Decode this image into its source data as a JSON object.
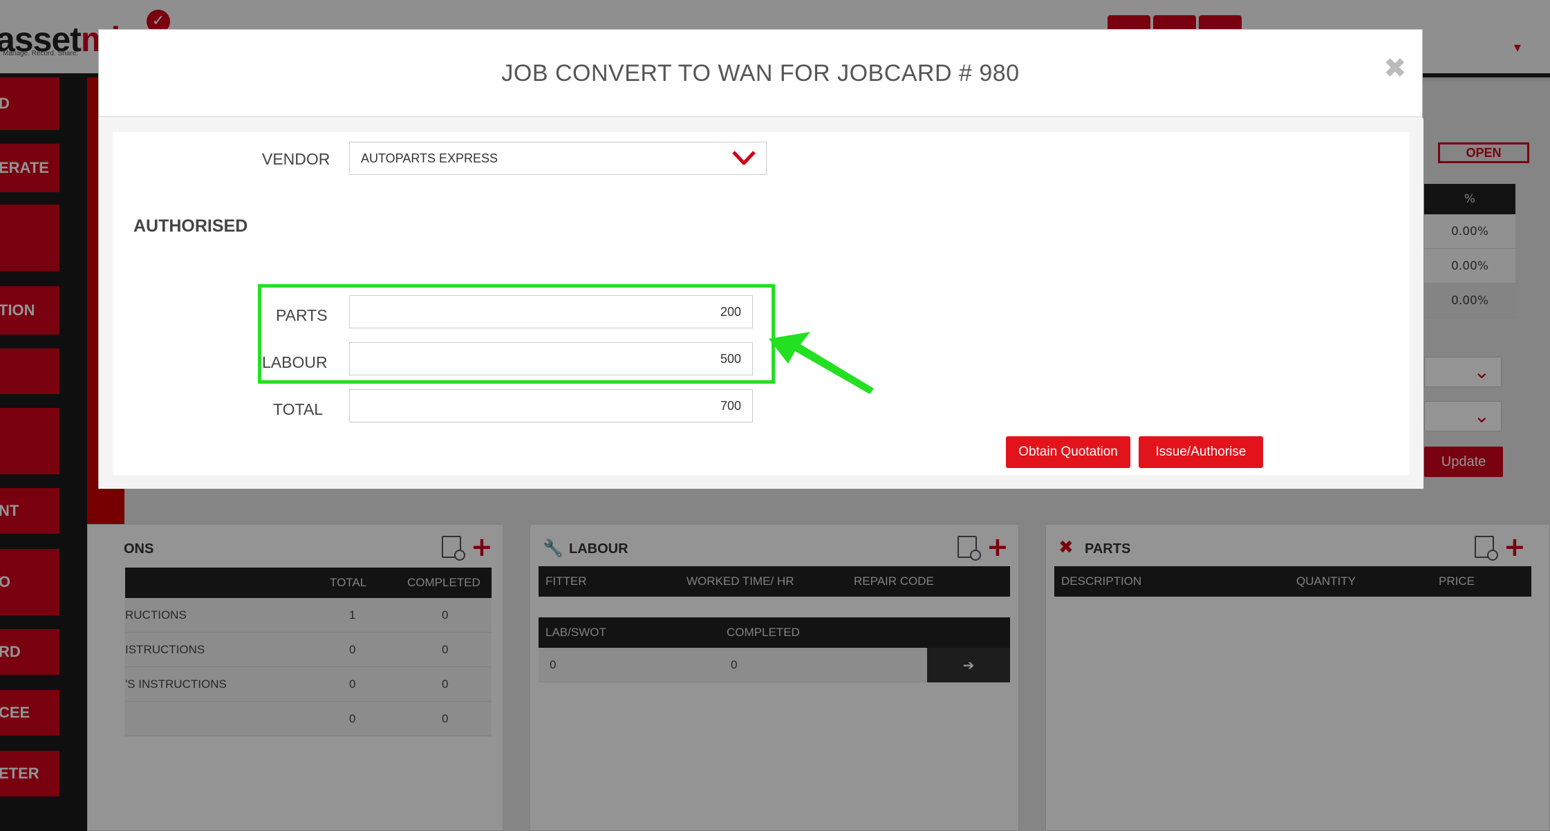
{
  "app": {
    "logo_main": "asset",
    "logo_accent": "mi",
    "logo_tagline": "Manage. Record. Share."
  },
  "nav": {
    "items": [
      "D",
      "ERATE",
      "",
      "TION",
      "",
      "",
      "NT",
      "O",
      "RD",
      "CEE",
      "ETER"
    ]
  },
  "background": {
    "status_badge": "OPEN",
    "pct_header": "%",
    "pct_values": [
      "0.00%",
      "0.00%",
      "0.00%"
    ],
    "update_label": "Update",
    "instructions_panel": {
      "title": "ONS",
      "headers": [
        "TOTAL",
        "COMPLETED"
      ],
      "rows": [
        {
          "name": "RUCTIONS",
          "total": "1",
          "completed": "0"
        },
        {
          "name": "ISTRUCTIONS",
          "total": "0",
          "completed": "0"
        },
        {
          "name": "'S INSTRUCTIONS",
          "total": "0",
          "completed": "0"
        },
        {
          "name": "",
          "total": "0",
          "completed": "0"
        }
      ]
    },
    "labour_panel": {
      "title": "LABOUR",
      "headers": [
        "FITTER",
        "WORKED TIME/ HR",
        "REPAIR CODE"
      ],
      "sub_headers": [
        "LAB/SWOT",
        "COMPLETED"
      ],
      "sub_row": [
        "0",
        "0"
      ]
    },
    "parts_panel": {
      "title": "PARTS",
      "headers": [
        "DESCRIPTION",
        "QUANTITY",
        "PRICE"
      ]
    }
  },
  "modal": {
    "title": "JOB CONVERT TO WAN FOR JOBCARD # 980",
    "vendor_label": "VENDOR",
    "vendor_value": "AUTOPARTS EXPRESS",
    "section_title": "AUTHORISED",
    "parts_label": "PARTS",
    "parts_value": "200",
    "labour_label": "LABOUR",
    "labour_value": "500",
    "total_label": "TOTAL",
    "total_value": "700",
    "obtain_quotation_label": "Obtain Quotation",
    "issue_authorise_label": "Issue/Authorise"
  },
  "colors": {
    "accent": "#d0021b",
    "highlight": "#23e022"
  }
}
